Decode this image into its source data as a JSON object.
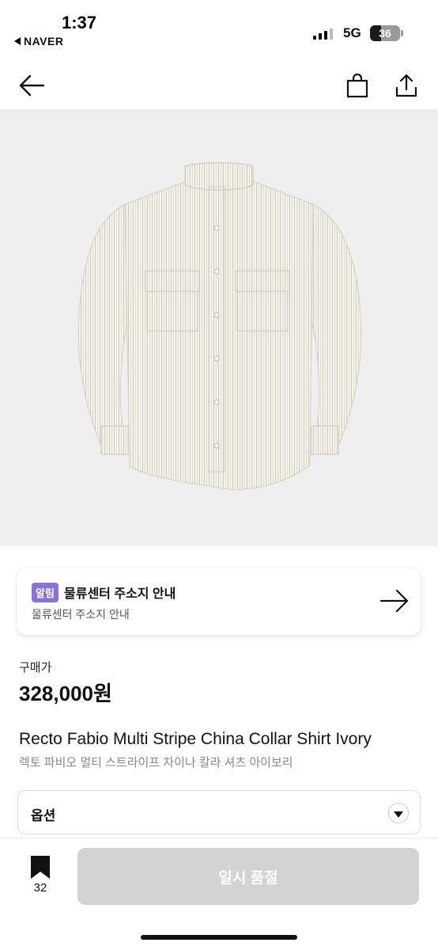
{
  "status_bar": {
    "time": "1:37",
    "back_app": "NAVER",
    "network": "5G",
    "battery": "36",
    "battery_level": 0.36
  },
  "header": {
    "icons": [
      "back-arrow-icon",
      "shopping-bag-icon",
      "share-icon"
    ]
  },
  "product_image": {
    "subject": "shirt",
    "background": "#efefef"
  },
  "notice": {
    "badge": "알림",
    "badge_color": "#8b73d6",
    "title": "물류센터 주소지 안내",
    "subtitle": "물류센터 주소지 안내",
    "icon": "arrow-right-icon"
  },
  "price": {
    "label": "구매가",
    "value": "328,000원"
  },
  "product": {
    "name_en": "Recto Fabio Multi Stripe China Collar Shirt Ivory",
    "name_ko": "렉토 파비오 멀티 스트라이프 차이나 칼라 셔츠 아이보리"
  },
  "option": {
    "label": "옵션",
    "icon": "chevron-down-icon"
  },
  "bottom_bar": {
    "bookmark_count": "32",
    "button_label": "일시 품절",
    "button_color": "#d3d3d3"
  }
}
